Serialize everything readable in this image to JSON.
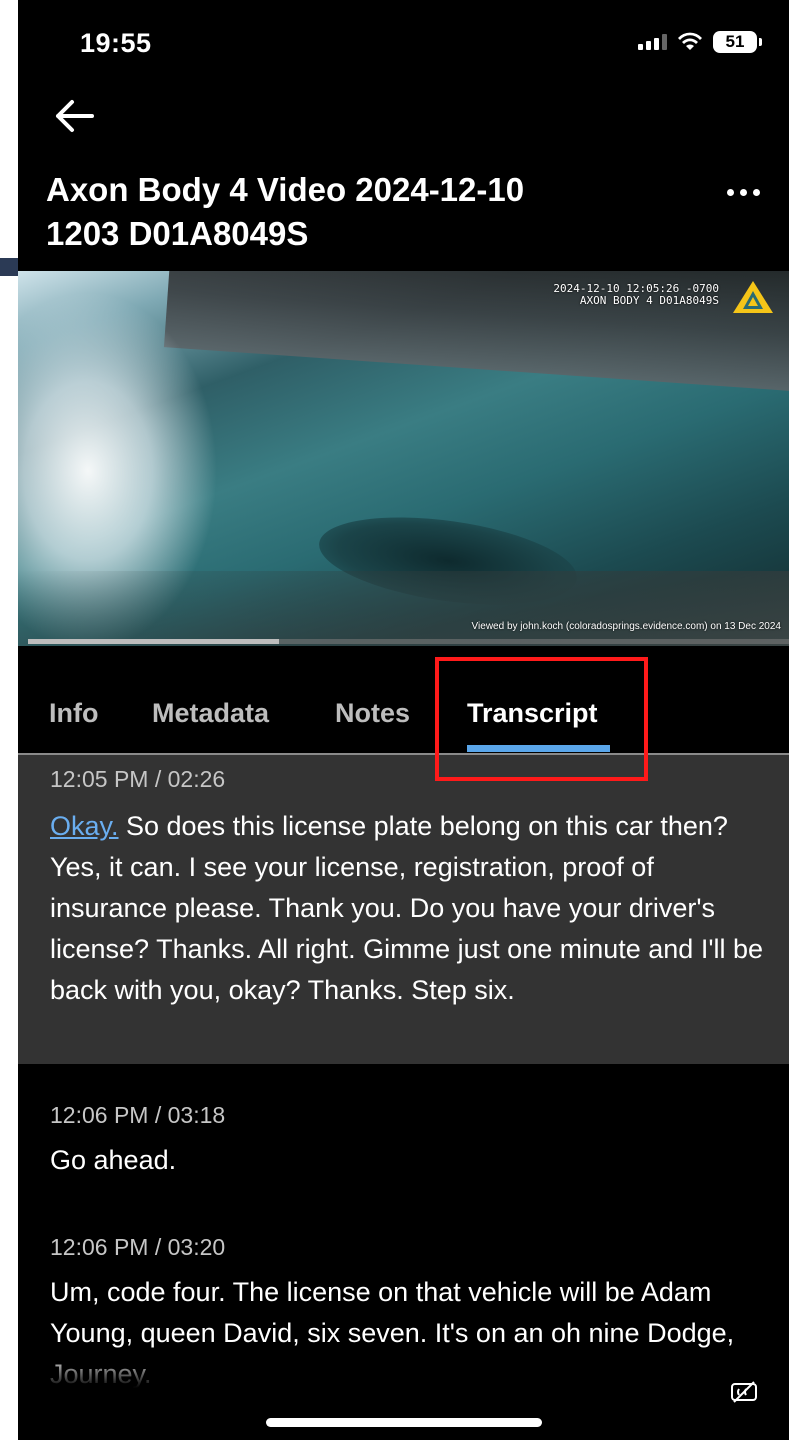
{
  "status_bar": {
    "time": "19:55",
    "battery": "51"
  },
  "header": {
    "title": "Axon Body 4 Video 2024-12-10 1203 D01A8049S",
    "title_line1": "Axon Body 4 Video 2024-12-10",
    "title_line2": "1203 D01A8049S",
    "back_icon": "arrow-left-icon",
    "more_icon": "more-horizontal-icon"
  },
  "video": {
    "overlay_line1": "2024-12-10 12:05:26 -0700",
    "overlay_line2": "AXON BODY 4 D01A8049S",
    "watermark": "Viewed by john.koch (coloradosprings.evidence.com) on 13 Dec 2024",
    "progress_fraction": 0.33,
    "logo_color": "#f5c518"
  },
  "tabs": [
    {
      "label": "Info"
    },
    {
      "label": "Metadata"
    },
    {
      "label": "Notes"
    },
    {
      "label": "Transcript",
      "active": true
    }
  ],
  "transcript": [
    {
      "time": "12:05 PM / 02:26",
      "highlight_word": "Okay.",
      "text": " So does this license plate belong on this car then? Yes, it can. I see your license, registration, proof of insurance please. Thank you. Do you have your driver's license? Thanks. All right. Gimme just one minute and I'll be back with you, okay? Thanks. Step six."
    },
    {
      "time": "12:06 PM / 03:18",
      "text": "Go ahead."
    },
    {
      "time": "12:06 PM / 03:20",
      "text": "Um, code four. The license on that vehicle will be Adam Young, queen David, six seven. It's on an oh nine Dodge, Journey."
    }
  ],
  "colors": {
    "accent": "#5aa6ea",
    "highlight_box": "#ff1a1a",
    "active_entry_bg": "#333333"
  }
}
